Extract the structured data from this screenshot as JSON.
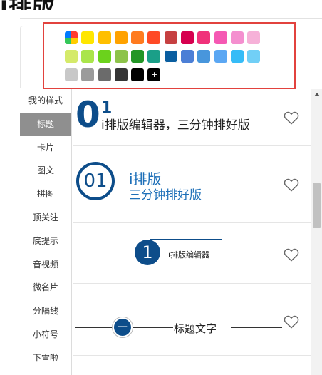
{
  "brand": {
    "title": "i排版"
  },
  "color_palette": {
    "rows": [
      [
        "rainbow",
        "#ffe600",
        "#ffbf00",
        "#ffa200",
        "#ff7b1f",
        "#ff4a26",
        "#c64041",
        "#d6004f",
        "#f0327a",
        "#f558b3",
        "#f48fcf",
        "#f6b1d8"
      ],
      [
        "#d5ea6a",
        "#aae54b",
        "#6bd21c",
        "#8dc34a",
        "#239626",
        "#1a9f88",
        "#0a5ea0",
        "#4c7fd6",
        "#4896dc",
        "#5ba7f3",
        "#36bcf7",
        "#71cff6"
      ],
      [
        "#c8c8c8",
        "#9b9b9b",
        "#6b6b6b",
        "#353535",
        "#000000",
        "+"
      ]
    ],
    "selected": "#0a5ea0"
  },
  "sidebar": {
    "items": [
      {
        "label": "我的样式"
      },
      {
        "label": "标题"
      },
      {
        "label": "卡片"
      },
      {
        "label": "图文"
      },
      {
        "label": "拼图"
      },
      {
        "label": "顶关注"
      },
      {
        "label": "底提示"
      },
      {
        "label": "音视频"
      },
      {
        "label": "微名片"
      },
      {
        "label": "分隔线"
      },
      {
        "label": "小符号"
      },
      {
        "label": "下雪啦"
      }
    ],
    "active_index": 1
  },
  "templates": {
    "t1": {
      "big_digit": "0",
      "small_digit": "1",
      "text": "i排版编辑器，三分钟排好版"
    },
    "t2": {
      "number": "01",
      "title": "i排版",
      "subtitle": "三分钟排好版"
    },
    "t3": {
      "number": "1",
      "text": "i排版编辑器"
    },
    "t4": {
      "symbol": "—",
      "text": "标题文字"
    }
  },
  "colors": {
    "accent": "#0d4d8a",
    "highlight_border": "#e2423e",
    "sidebar_active": "#8f8f8f"
  }
}
